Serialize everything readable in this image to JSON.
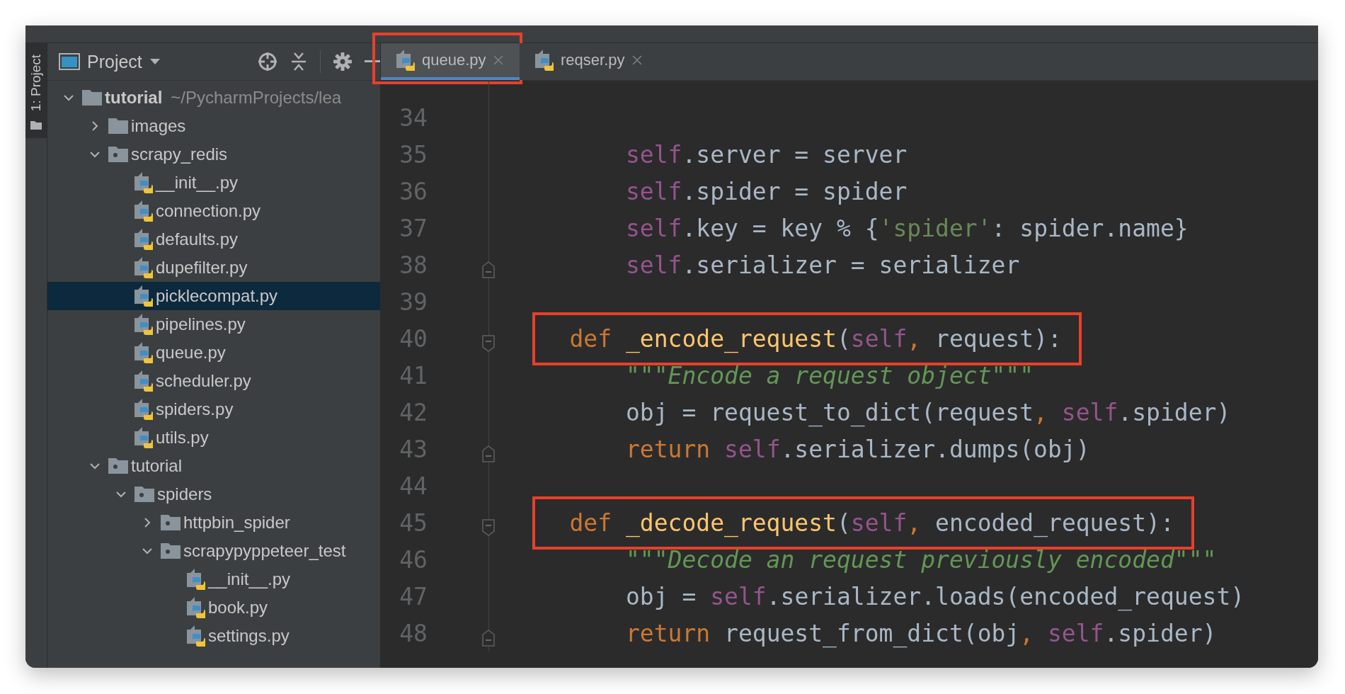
{
  "side_strip": {
    "label": "1: Project"
  },
  "project_panel": {
    "title": "Project",
    "tree": [
      {
        "label": "tutorial",
        "path": "~/PycharmProjects/lea",
        "kind": "folder",
        "expanded": true,
        "selected": false,
        "children": [
          {
            "label": "images",
            "kind": "folder",
            "expanded": false,
            "selected": false
          },
          {
            "label": "scrapy_redis",
            "kind": "package",
            "expanded": true,
            "selected": false,
            "children": [
              {
                "label": "__init__.py",
                "kind": "python",
                "selected": false
              },
              {
                "label": "connection.py",
                "kind": "python",
                "selected": false
              },
              {
                "label": "defaults.py",
                "kind": "python",
                "selected": false
              },
              {
                "label": "dupefilter.py",
                "kind": "python",
                "selected": false
              },
              {
                "label": "picklecompat.py",
                "kind": "python",
                "selected": true
              },
              {
                "label": "pipelines.py",
                "kind": "python",
                "selected": false
              },
              {
                "label": "queue.py",
                "kind": "python",
                "selected": false
              },
              {
                "label": "scheduler.py",
                "kind": "python",
                "selected": false
              },
              {
                "label": "spiders.py",
                "kind": "python",
                "selected": false
              },
              {
                "label": "utils.py",
                "kind": "python",
                "selected": false
              }
            ]
          },
          {
            "label": "tutorial",
            "kind": "package",
            "expanded": true,
            "selected": false,
            "children": [
              {
                "label": "spiders",
                "kind": "package",
                "expanded": true,
                "selected": false,
                "children": [
                  {
                    "label": "httpbin_spider",
                    "kind": "package",
                    "expanded": false,
                    "selected": false
                  },
                  {
                    "label": "scrapypyppeteer_test",
                    "kind": "package",
                    "expanded": true,
                    "selected": false,
                    "children": [
                      {
                        "label": "__init__.py",
                        "kind": "python",
                        "selected": false
                      },
                      {
                        "label": "book.py",
                        "kind": "python",
                        "selected": false
                      },
                      {
                        "label": "settings.py",
                        "kind": "python",
                        "selected": false
                      }
                    ]
                  }
                ]
              }
            ]
          }
        ]
      }
    ]
  },
  "tabs": [
    {
      "label": "queue.py",
      "selected": true,
      "annotated": true
    },
    {
      "label": "reqser.py",
      "selected": false,
      "annotated": false
    }
  ],
  "editor": {
    "lines": [
      {
        "children": [
          {
            "number": "34",
            "kind": "blank"
          },
          {
            "number": "35",
            "kind": "code",
            "tokens": [
              {
                "color": "#94558d",
                "t": "self"
              },
              {
                "color": "#a9b7c6",
                "t": ".server = server"
              }
            ]
          },
          {
            "number": "36",
            "kind": "code",
            "tokens": [
              {
                "color": "#94558d",
                "t": "self"
              },
              {
                "color": "#a9b7c6",
                "t": ".spider = spider"
              }
            ]
          },
          {
            "number": "37",
            "kind": "code",
            "tokens": [
              {
                "color": "#94558d",
                "t": "self"
              },
              {
                "color": "#a9b7c6",
                "t": ".key = key % {"
              },
              {
                "color": "#6a8759",
                "t": "'spider'"
              },
              {
                "color": "#a9b7c6",
                "t": ": spider.name}"
              }
            ]
          },
          {
            "number": "38",
            "kind": "block_end",
            "tokens": [
              {
                "color": "#94558d",
                "t": "self"
              },
              {
                "color": "#a9b7c6",
                "t": ".serializer = serializer"
              }
            ]
          }
        ]
      },
      {
        "number": "39",
        "kind": "blank"
      },
      {
        "number": "40",
        "kind": "block_start",
        "annotated": true,
        "tokens": [
          {
            "color": "#cc7832",
            "t": "def"
          },
          {
            "color": "#ffc66d",
            "t": " _encode_request"
          },
          {
            "color": "#a9b7c6",
            "t": "("
          },
          {
            "color": "#94558d",
            "t": "self"
          },
          {
            "color": "#cc7832",
            "t": ","
          },
          {
            "color": "#a9b7c6",
            "t": " request):"
          }
        ],
        "children": [
          {
            "number": "41",
            "kind": "code",
            "tokens": [
              {
                "color": "#629755",
                "t": "*\"\"\"Encode a request object\"\"\"*"
              }
            ]
          },
          {
            "number": "42",
            "kind": "code",
            "tokens": [
              {
                "color": "#a9b7c6",
                "t": "obj = request_to_dict(request"
              },
              {
                "color": "#cc7832",
                "t": ","
              },
              {
                "color": "#94558d",
                "t": " self"
              },
              {
                "color": "#a9b7c6",
                "t": ".spider)"
              }
            ]
          },
          {
            "number": "43",
            "kind": "block_end",
            "tokens": [
              {
                "color": "#cc7832",
                "t": "return"
              },
              {
                "color": "#94558d",
                "t": " self"
              },
              {
                "color": "#a9b7c6",
                "t": ".serializer.dumps(obj)"
              }
            ]
          }
        ]
      },
      {
        "number": "44",
        "kind": "blank"
      },
      {
        "number": "45",
        "kind": "block_start",
        "annotated": true,
        "tokens": [
          {
            "color": "#cc7832",
            "t": "def"
          },
          {
            "color": "#ffc66d",
            "t": " _decode_request"
          },
          {
            "color": "#a9b7c6",
            "t": "("
          },
          {
            "color": "#94558d",
            "t": "self"
          },
          {
            "color": "#cc7832",
            "t": ","
          },
          {
            "color": "#a9b7c6",
            "t": " encoded_request):"
          }
        ],
        "children": [
          {
            "number": "46",
            "kind": "code",
            "tokens": [
              {
                "color": "#629755",
                "t": "*\"\"\"Decode an request previously encoded\"\"\"*"
              }
            ]
          },
          {
            "number": "47",
            "kind": "code",
            "tokens": [
              {
                "color": "#a9b7c6",
                "t": "obj = "
              },
              {
                "color": "#94558d",
                "t": "self"
              },
              {
                "color": "#a9b7c6",
                "t": ".serializer.loads(encoded_request)"
              }
            ]
          },
          {
            "number": "48",
            "kind": "block_end",
            "tokens": [
              {
                "color": "#cc7832",
                "t": "return"
              },
              {
                "color": "#a9b7c6",
                "t": " request_from_dict(obj"
              },
              {
                "color": "#cc7832",
                "t": ","
              },
              {
                "color": "#94558d",
                "t": " self"
              },
              {
                "color": "#a9b7c6",
                "t": ".spider)"
              }
            ]
          }
        ]
      }
    ]
  }
}
